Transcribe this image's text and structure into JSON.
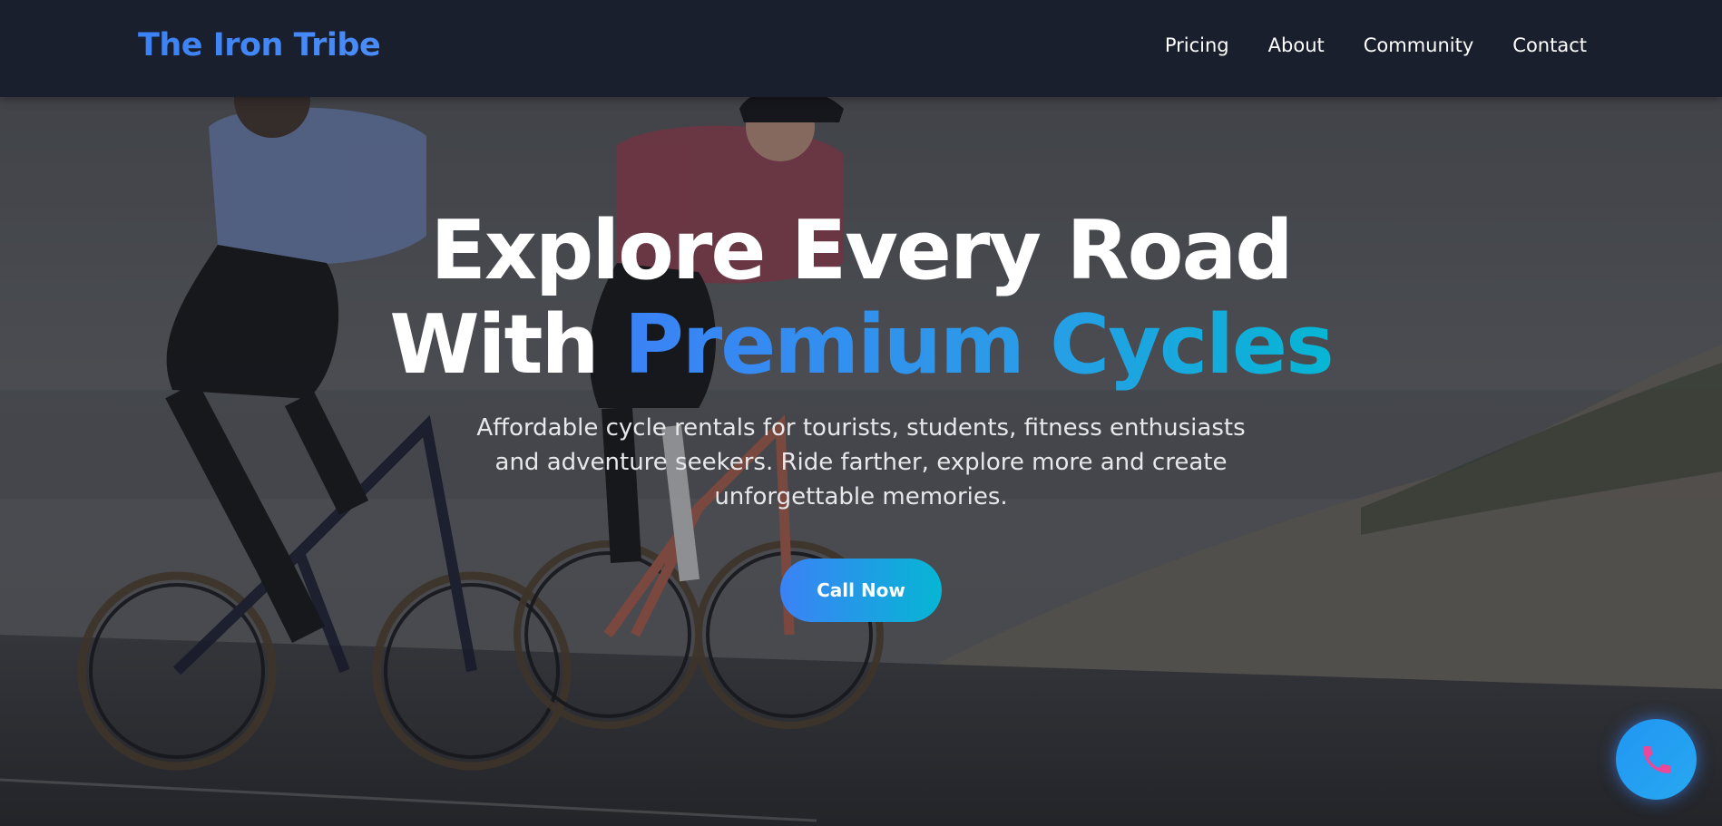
{
  "brand": {
    "name": "The Iron Tribe"
  },
  "nav": {
    "items": [
      {
        "label": "Pricing"
      },
      {
        "label": "About"
      },
      {
        "label": "Community"
      },
      {
        "label": "Contact"
      }
    ]
  },
  "hero": {
    "headline_line1": "Explore Every Road",
    "headline_line2_prefix": "With ",
    "headline_line2_accent": "Premium Cycles",
    "subtitle": "Affordable cycle rentals for tourists, students, fitness enthusiasts and adventure seekers. Ride farther, explore more and create unforgettable memories.",
    "cta_label": "Call Now",
    "background_description_icon": "cyclists-photo"
  },
  "floating_button": {
    "icon": "phone-icon"
  },
  "colors": {
    "navbar_bg": "#1a1f2e",
    "brand_blue": "#3b82f6",
    "accent_cyan": "#06b6d4",
    "phone_icon_pink": "#ec4899"
  }
}
